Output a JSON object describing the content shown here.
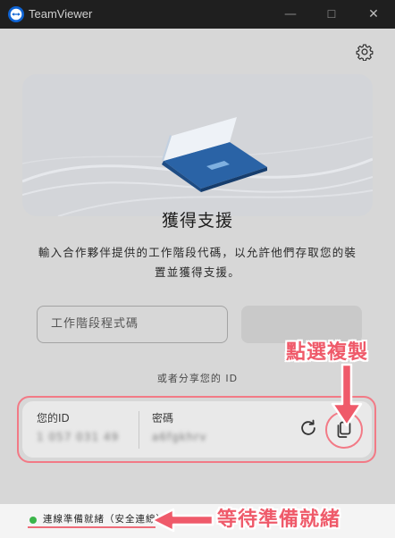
{
  "window": {
    "title": "TeamViewer",
    "controls": [
      "—",
      "☐",
      "✕"
    ]
  },
  "main": {
    "heading": "獲得支援",
    "description": "輸入合作夥伴提供的工作階段代碼，以允許他們存取您的裝置並獲得支援。",
    "session_placeholder": "工作階段程式碼",
    "share_label": "或者分享您的 ID"
  },
  "id_card": {
    "id_label": "您的ID",
    "id_value": "1 057 031 49",
    "password_label": "密碼",
    "password_value": "a6fgkhrv"
  },
  "status": {
    "text": "連線準備就緒（安全連線）",
    "color": "#3bb54a"
  },
  "annotations": {
    "copy": "點選複製",
    "wait": "等待準備就緒",
    "color": "#ef5a6a"
  }
}
